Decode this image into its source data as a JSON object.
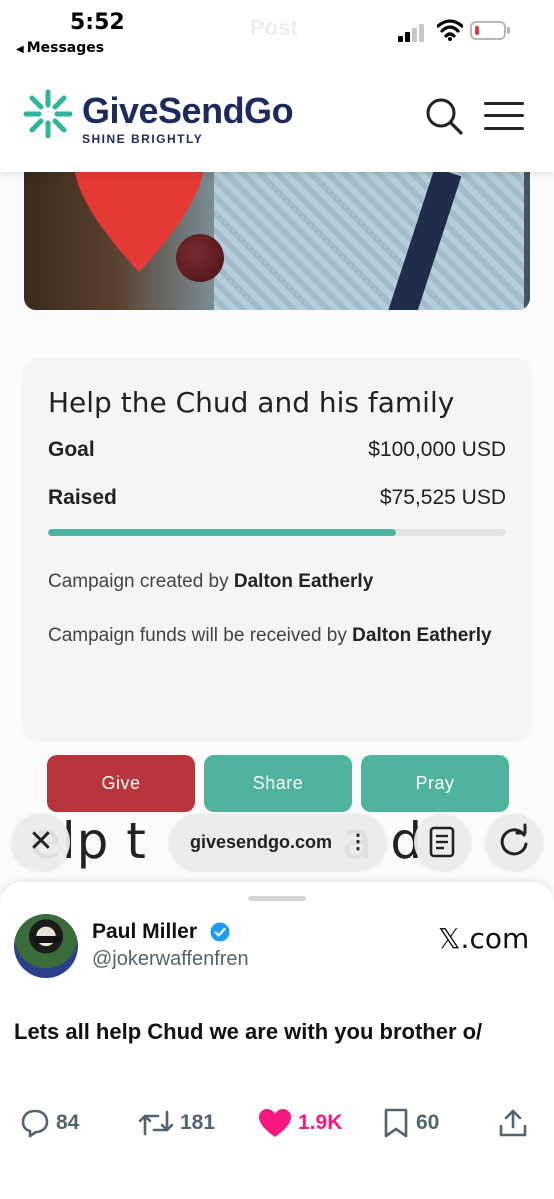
{
  "status_bar": {
    "time": "5:52",
    "back_app": "Messages",
    "ghost_title": "Post",
    "battery_level": 0.15
  },
  "header": {
    "logo_name": "GiveSendGo",
    "logo_tagline": "SHINE BRIGHTLY",
    "search_icon": "search-icon",
    "menu_icon": "hamburger-menu-icon"
  },
  "campaign": {
    "title": "Help the Chud and his family",
    "goal_label": "Goal",
    "goal_value": "$100,000 USD",
    "raised_label": "Raised",
    "raised_value": "$75,525 USD",
    "progress_fraction": 0.76,
    "created_by_prefix": "Campaign created by ",
    "created_by_name": "Dalton Eatherly",
    "funds_prefix": "Campaign funds will be received by ",
    "funds_name": "Dalton Eatherly"
  },
  "actions": {
    "give": "Give",
    "share": "Share",
    "pray": "Pray"
  },
  "background_heading": "elp t",
  "background_heading_2": "a d",
  "browser_toolbar": {
    "url": "givesendgo.com",
    "more": "⋮"
  },
  "tweet": {
    "author_name": "Paul Miller",
    "author_handle": "@jokerwaffenfren",
    "source": "𝕏.com",
    "text": "Lets all help Chud we are with you brother o/",
    "replies": "84",
    "retweets": "181",
    "likes": "1.9K",
    "bookmarks": "60"
  },
  "colors": {
    "brand_teal": "#4fb39f",
    "brand_navy": "#1d2a5c",
    "give_red": "#b8353b",
    "like_pink": "#f91880",
    "verified_blue": "#1d9bf0"
  }
}
